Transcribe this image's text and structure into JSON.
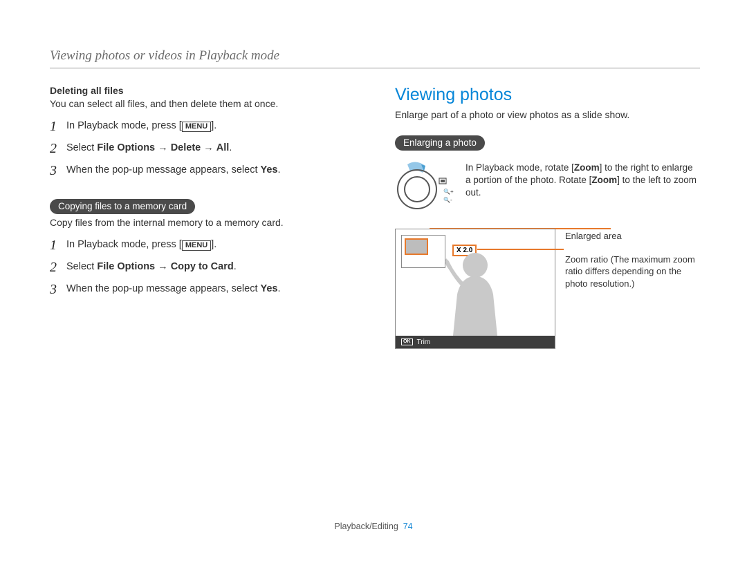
{
  "header": {
    "title": "Viewing photos or videos in Playback mode"
  },
  "left": {
    "sectionA": {
      "subhead": "Deleting all files",
      "intro": "You can select all files, and then delete them at once.",
      "steps": [
        {
          "n": "1",
          "pre": "In Playback mode, press [",
          "btn": "MENU",
          "post": "]."
        },
        {
          "n": "2",
          "pre": "Select ",
          "bold1": "File Options",
          "arrow1": " → ",
          "bold2": "Delete",
          "arrow2": " → ",
          "bold3": "All",
          "post": "."
        },
        {
          "n": "3",
          "pre": "When the pop-up message appears, select ",
          "bold1": "Yes",
          "post": "."
        }
      ]
    },
    "sectionB": {
      "pill": "Copying files to a memory card",
      "intro": "Copy files from the internal memory to a memory card.",
      "steps": [
        {
          "n": "1",
          "pre": "In Playback mode, press [",
          "btn": "MENU",
          "post": "]."
        },
        {
          "n": "2",
          "pre": "Select ",
          "bold1": "File Options",
          "arrow1": " → ",
          "bold2": "Copy to Card",
          "post": "."
        },
        {
          "n": "3",
          "pre": "When the pop-up message appears, select ",
          "bold1": "Yes",
          "post": "."
        }
      ]
    }
  },
  "right": {
    "title": "Viewing photos",
    "intro": "Enlarge part of a photo or view photos as a slide show.",
    "pill": "Enlarging a photo",
    "zoom_text_pre": "In Playback mode, rotate [",
    "zoom_bold1": "Zoom",
    "zoom_text_mid": "] to the right to enlarge a portion of the photo. Rotate [",
    "zoom_bold2": "Zoom",
    "zoom_text_post": "] to the left to zoom out.",
    "ratio": "X 2.0",
    "trim_ok": "OK",
    "trim_label": "Trim",
    "callout1": "Enlarged area",
    "callout2": "Zoom ratio (The maximum zoom ratio differs depending on the photo resolution.)"
  },
  "footer": {
    "section": "Playback/Editing",
    "page": "74"
  }
}
